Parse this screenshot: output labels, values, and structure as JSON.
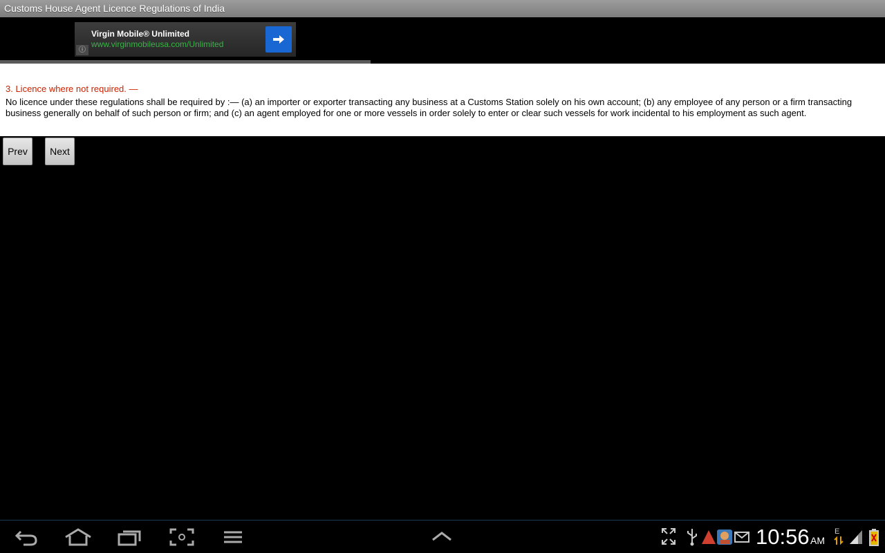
{
  "app": {
    "title": "Customs House Agent Licence Regulations of India"
  },
  "ad": {
    "title": "Virgin Mobile® Unlimited",
    "url": "www.virginmobileusa.com/Unlimited",
    "info_icon": "info-icon",
    "go_icon": "arrow-right-icon",
    "accent_color": "#1967d2",
    "url_color": "#3db14a"
  },
  "section": {
    "heading": "3. Licence where not required. —",
    "body": "No licence under these regulations shall be required by :— (a) an importer or exporter transacting any business at a Customs Station solely on his own account; (b) any employee of any person or a firm transacting business generally on behalf of such person or firm; and (c) an agent employed for one or more vessels in order solely to enter or clear such vessels for work incidental to his employment as such agent.",
    "heading_color": "#cc2200"
  },
  "navigation": {
    "prev_label": "Prev",
    "next_label": "Next"
  },
  "system_bar": {
    "time": "10:56",
    "ampm": "AM",
    "network": "E"
  }
}
